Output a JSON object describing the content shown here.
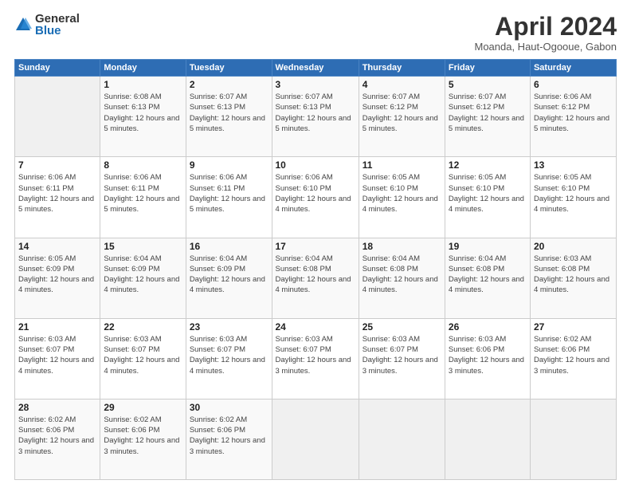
{
  "header": {
    "logo_general": "General",
    "logo_blue": "Blue",
    "month_title": "April 2024",
    "subtitle": "Moanda, Haut-Ogooue, Gabon"
  },
  "days_of_week": [
    "Sunday",
    "Monday",
    "Tuesday",
    "Wednesday",
    "Thursday",
    "Friday",
    "Saturday"
  ],
  "weeks": [
    [
      {
        "day": "",
        "info": ""
      },
      {
        "day": "1",
        "info": "Sunrise: 6:08 AM\nSunset: 6:13 PM\nDaylight: 12 hours\nand 5 minutes."
      },
      {
        "day": "2",
        "info": "Sunrise: 6:07 AM\nSunset: 6:13 PM\nDaylight: 12 hours\nand 5 minutes."
      },
      {
        "day": "3",
        "info": "Sunrise: 6:07 AM\nSunset: 6:13 PM\nDaylight: 12 hours\nand 5 minutes."
      },
      {
        "day": "4",
        "info": "Sunrise: 6:07 AM\nSunset: 6:12 PM\nDaylight: 12 hours\nand 5 minutes."
      },
      {
        "day": "5",
        "info": "Sunrise: 6:07 AM\nSunset: 6:12 PM\nDaylight: 12 hours\nand 5 minutes."
      },
      {
        "day": "6",
        "info": "Sunrise: 6:06 AM\nSunset: 6:12 PM\nDaylight: 12 hours\nand 5 minutes."
      }
    ],
    [
      {
        "day": "7",
        "info": "Sunrise: 6:06 AM\nSunset: 6:11 PM\nDaylight: 12 hours\nand 5 minutes."
      },
      {
        "day": "8",
        "info": "Sunrise: 6:06 AM\nSunset: 6:11 PM\nDaylight: 12 hours\nand 5 minutes."
      },
      {
        "day": "9",
        "info": "Sunrise: 6:06 AM\nSunset: 6:11 PM\nDaylight: 12 hours\nand 5 minutes."
      },
      {
        "day": "10",
        "info": "Sunrise: 6:06 AM\nSunset: 6:10 PM\nDaylight: 12 hours\nand 4 minutes."
      },
      {
        "day": "11",
        "info": "Sunrise: 6:05 AM\nSunset: 6:10 PM\nDaylight: 12 hours\nand 4 minutes."
      },
      {
        "day": "12",
        "info": "Sunrise: 6:05 AM\nSunset: 6:10 PM\nDaylight: 12 hours\nand 4 minutes."
      },
      {
        "day": "13",
        "info": "Sunrise: 6:05 AM\nSunset: 6:10 PM\nDaylight: 12 hours\nand 4 minutes."
      }
    ],
    [
      {
        "day": "14",
        "info": "Sunrise: 6:05 AM\nSunset: 6:09 PM\nDaylight: 12 hours\nand 4 minutes."
      },
      {
        "day": "15",
        "info": "Sunrise: 6:04 AM\nSunset: 6:09 PM\nDaylight: 12 hours\nand 4 minutes."
      },
      {
        "day": "16",
        "info": "Sunrise: 6:04 AM\nSunset: 6:09 PM\nDaylight: 12 hours\nand 4 minutes."
      },
      {
        "day": "17",
        "info": "Sunrise: 6:04 AM\nSunset: 6:08 PM\nDaylight: 12 hours\nand 4 minutes."
      },
      {
        "day": "18",
        "info": "Sunrise: 6:04 AM\nSunset: 6:08 PM\nDaylight: 12 hours\nand 4 minutes."
      },
      {
        "day": "19",
        "info": "Sunrise: 6:04 AM\nSunset: 6:08 PM\nDaylight: 12 hours\nand 4 minutes."
      },
      {
        "day": "20",
        "info": "Sunrise: 6:03 AM\nSunset: 6:08 PM\nDaylight: 12 hours\nand 4 minutes."
      }
    ],
    [
      {
        "day": "21",
        "info": "Sunrise: 6:03 AM\nSunset: 6:07 PM\nDaylight: 12 hours\nand 4 minutes."
      },
      {
        "day": "22",
        "info": "Sunrise: 6:03 AM\nSunset: 6:07 PM\nDaylight: 12 hours\nand 4 minutes."
      },
      {
        "day": "23",
        "info": "Sunrise: 6:03 AM\nSunset: 6:07 PM\nDaylight: 12 hours\nand 4 minutes."
      },
      {
        "day": "24",
        "info": "Sunrise: 6:03 AM\nSunset: 6:07 PM\nDaylight: 12 hours\nand 3 minutes."
      },
      {
        "day": "25",
        "info": "Sunrise: 6:03 AM\nSunset: 6:07 PM\nDaylight: 12 hours\nand 3 minutes."
      },
      {
        "day": "26",
        "info": "Sunrise: 6:03 AM\nSunset: 6:06 PM\nDaylight: 12 hours\nand 3 minutes."
      },
      {
        "day": "27",
        "info": "Sunrise: 6:02 AM\nSunset: 6:06 PM\nDaylight: 12 hours\nand 3 minutes."
      }
    ],
    [
      {
        "day": "28",
        "info": "Sunrise: 6:02 AM\nSunset: 6:06 PM\nDaylight: 12 hours\nand 3 minutes."
      },
      {
        "day": "29",
        "info": "Sunrise: 6:02 AM\nSunset: 6:06 PM\nDaylight: 12 hours\nand 3 minutes."
      },
      {
        "day": "30",
        "info": "Sunrise: 6:02 AM\nSunset: 6:06 PM\nDaylight: 12 hours\nand 3 minutes."
      },
      {
        "day": "",
        "info": ""
      },
      {
        "day": "",
        "info": ""
      },
      {
        "day": "",
        "info": ""
      },
      {
        "day": "",
        "info": ""
      }
    ]
  ]
}
